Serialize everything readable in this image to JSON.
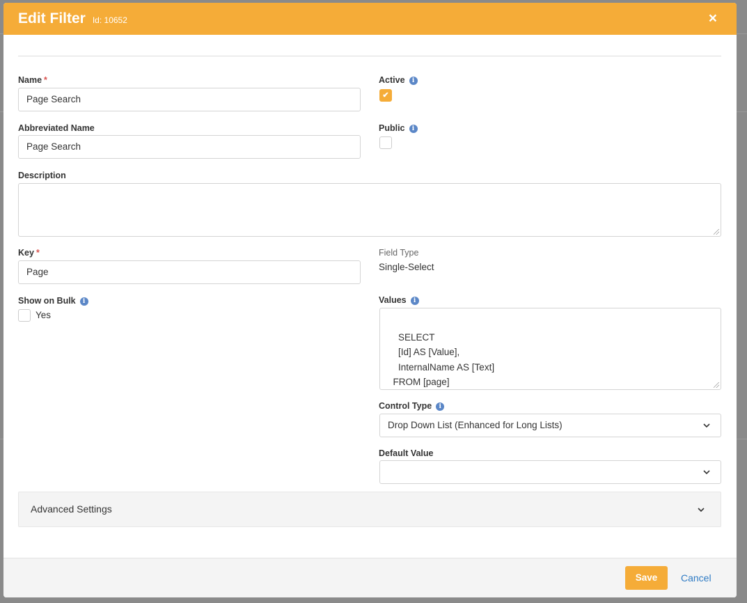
{
  "modal": {
    "title": "Edit Filter",
    "id_label": "Id: 10652",
    "close_glyph": "×"
  },
  "fields": {
    "name": {
      "label": "Name",
      "required_mark": "*",
      "value": "Page Search"
    },
    "abbreviated_name": {
      "label": "Abbreviated Name",
      "value": "Page Search"
    },
    "description": {
      "label": "Description",
      "value": ""
    },
    "key": {
      "label": "Key",
      "required_mark": "*",
      "value": "Page"
    },
    "show_on_bulk": {
      "label": "Show on Bulk",
      "option_label": "Yes",
      "checked": false
    },
    "active": {
      "label": "Active",
      "checked": true
    },
    "public": {
      "label": "Public",
      "checked": false
    },
    "field_type": {
      "label": "Field Type",
      "value": "Single-Select"
    },
    "values": {
      "label": "Values",
      "value": "SELECT\n    [Id] AS [Value],\n    InternalName AS [Text]\n  FROM [page]"
    },
    "control_type": {
      "label": "Control Type",
      "selected": "Drop Down List (Enhanced for Long Lists)"
    },
    "default_value": {
      "label": "Default Value",
      "selected": ""
    }
  },
  "advanced_settings": {
    "label": "Advanced Settings"
  },
  "footer": {
    "save_label": "Save",
    "cancel_label": "Cancel"
  },
  "icons": {
    "info": "info-icon",
    "close": "close-icon",
    "chevron": "chevron-down-icon",
    "check": "check-icon"
  },
  "colors": {
    "accent": "#f5ac38",
    "link": "#2f7bc4",
    "info": "#5b87c7",
    "required": "#d9534f"
  }
}
